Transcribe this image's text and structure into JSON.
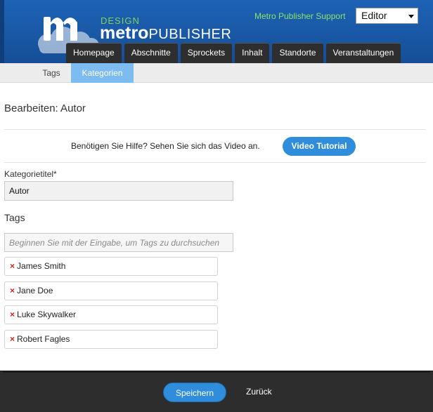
{
  "header": {
    "brand_design": "DESIGN",
    "brand_bold": "metro",
    "brand_light": "PUBLISHER",
    "logo_letter": "m",
    "support_link": "Metro Publisher Support",
    "role_selected": "Editor",
    "nav": [
      "Homepage",
      "Abschnitte",
      "Sprockets",
      "Inhalt",
      "Standorte",
      "Veranstaltungen"
    ]
  },
  "subnav": {
    "items": [
      {
        "label": "Tags",
        "active": false
      },
      {
        "label": "Kategorien",
        "active": true
      }
    ]
  },
  "main": {
    "title": "Bearbeiten: Autor",
    "help_text": "Benötigen Sie Hilfe? Sehen Sie sich das Video an.",
    "video_button": "Video Tutorial",
    "category_label": "Kategorietitel*",
    "category_value": "Autor",
    "tags_heading": "Tags",
    "tags_placeholder": "Beginnen Sie mit der Eingabe, um Tags zu durchsuchen",
    "tags": [
      "James Smith",
      "Jane Doe",
      "Luke Skywalker",
      "Robert Fagles"
    ],
    "remove_glyph": "×"
  },
  "footer": {
    "save": "Speichern",
    "back": "Zurück"
  },
  "colors": {
    "header_blue": "#1a5aa8",
    "accent_green": "#7fd35a",
    "active_tab": "#7cbcf0",
    "button_blue": "#2f8ddc",
    "remove_red": "#d9211a",
    "footer": "#2d2d2d"
  }
}
